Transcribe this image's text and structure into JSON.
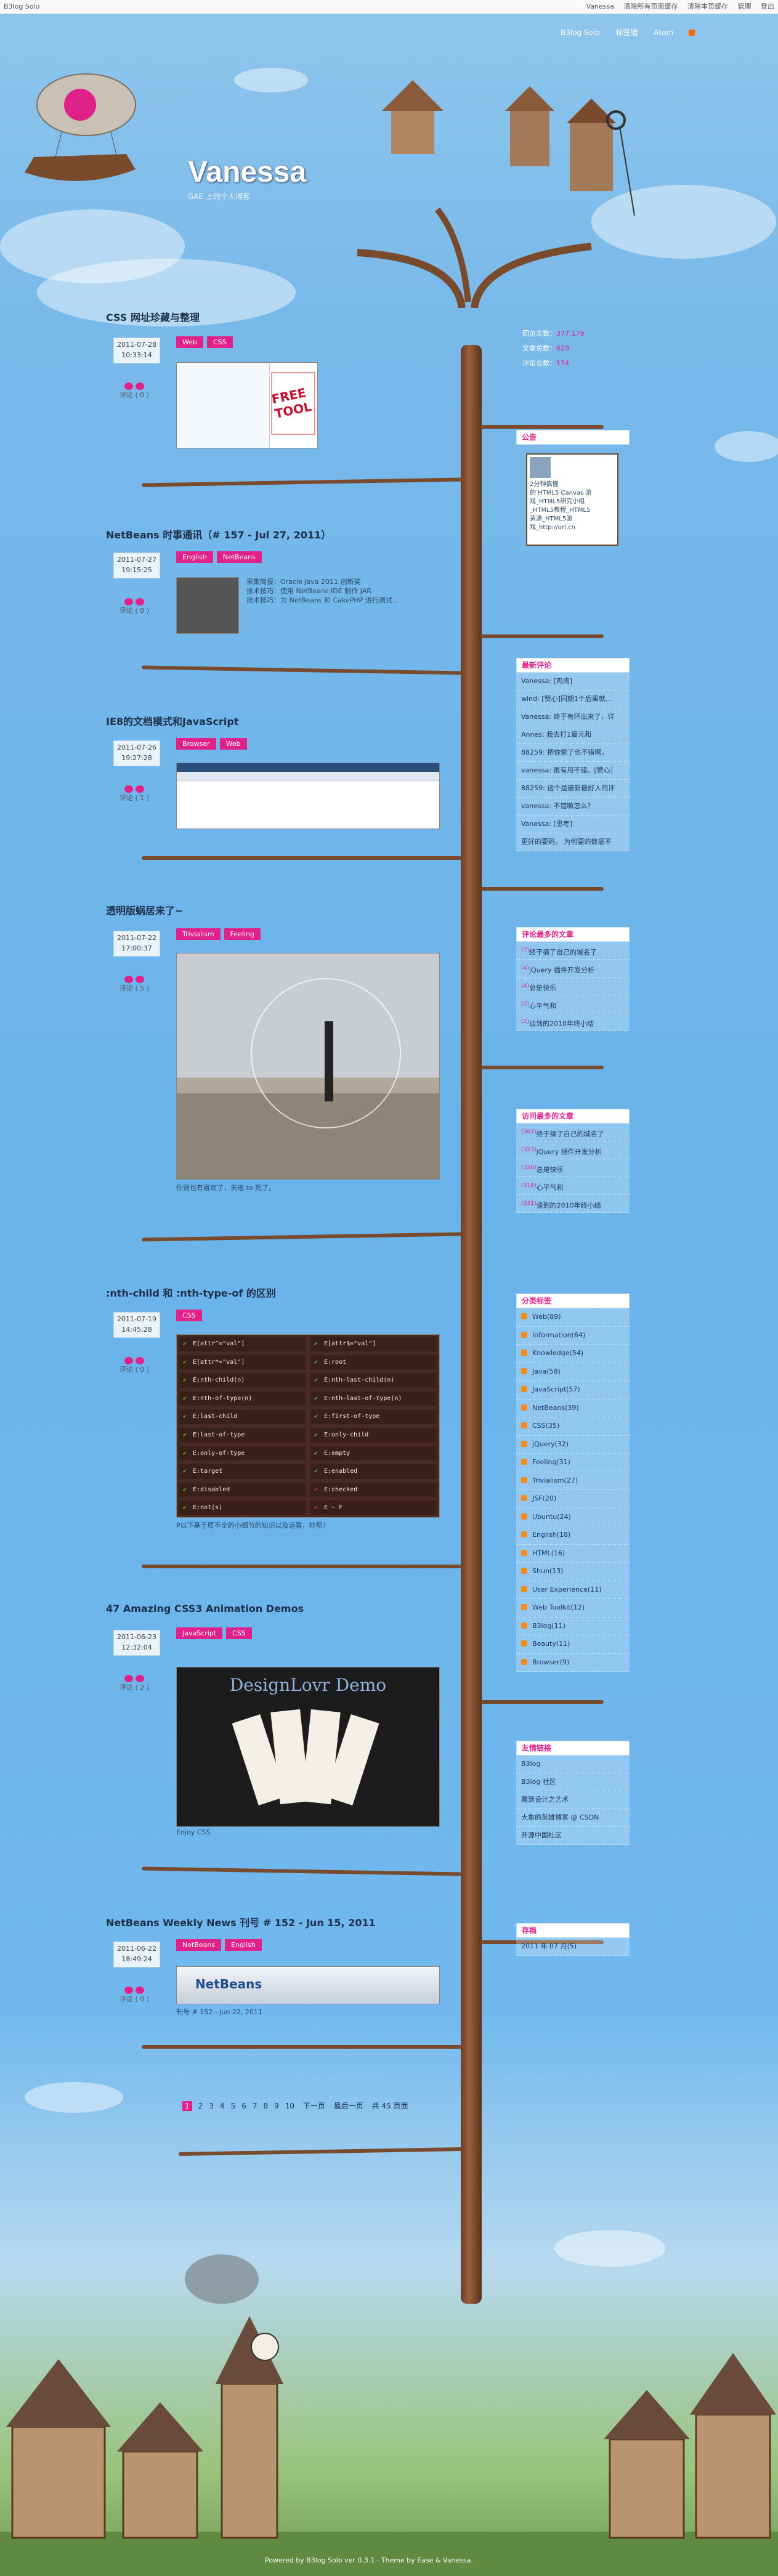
{
  "topbar": {
    "brand": "B3log Solo",
    "links": [
      "Vanessa",
      "清除所有页面缓存",
      "清除本页缓存",
      "管理",
      "登出"
    ]
  },
  "nav": {
    "home": "B3log Solo",
    "links": "标签墙",
    "rss": "Atom"
  },
  "blog": {
    "title": "Vanessa",
    "subtitle": "GAE 上的个人博客"
  },
  "stats": {
    "visits_label": "回览次数：",
    "visits": "377,179",
    "articles_label": "文章总数：",
    "articles": "629",
    "comments_label": "评论总数：",
    "comments": "134"
  },
  "posts": [
    {
      "title": "CSS 网址珍藏与整理",
      "date": "2011-07-28",
      "time": "10:33:14",
      "comment": "评论 ( 0 )",
      "tags": [
        "Web",
        "CSS"
      ],
      "caption": ""
    },
    {
      "title": "NetBeans 时事通讯（# 157 - Jul 27, 2011）",
      "date": "2011-07-27",
      "time": "19:15:25",
      "comment": "评论 ( 0 )",
      "tags": [
        "English",
        "NetBeans"
      ],
      "caption": "",
      "lines": [
        "采集简报：Oracle Java 2011 创新奖",
        "技术技巧：使用 NetBeans IDE 制作 JAR",
        "技术技巧：为 NetBeans 和 CakePHP 进行调试..."
      ]
    },
    {
      "title": "IE8的文档模式和JavaScript",
      "date": "2011-07-26",
      "time": "19:27:28",
      "comment": "评论 ( 1 )",
      "tags": [
        "Browser",
        "Web"
      ],
      "caption": ""
    },
    {
      "title": "透明版蜗居来了~",
      "date": "2011-07-22",
      "time": "17:00:37",
      "comment": "评论 ( 5 )",
      "tags": [
        "Trivialism",
        "Feeling"
      ],
      "caption": "你别也有喜欢了，天地 to 死了。"
    },
    {
      "title": ":nth-child 和 :nth-type-of 的区别",
      "date": "2011-07-19",
      "time": "14:45:28",
      "comment": "评论 ( 0 )",
      "tags": [
        "CSS"
      ],
      "caption": "P以下基于原不全的小细节的知识以及运算，抄帮！"
    },
    {
      "title": "47 Amazing CSS3 Animation Demos",
      "date": "2011-06-23",
      "time": "12:32:04",
      "comment": "评论 ( 2 )",
      "tags": [
        "JavaScript",
        "CSS"
      ],
      "caption": "Enjoy CSS"
    },
    {
      "title": "NetBeans Weekly News 刊号 # 152 - Jun 15, 2011",
      "date": "2011-06-22",
      "time": "18:49:24",
      "comment": "评论 ( 0 )",
      "tags": [
        "NetBeans",
        "English"
      ],
      "caption": "刊号 # 152 - Jun 22, 2011"
    }
  ],
  "selectors": [
    "E[attr^=\"val\"]",
    "E[attr$=\"val\"]",
    "E[attr*=\"val\"]",
    "E:root",
    "E:nth-child(n)",
    "E:nth-last-child(n)",
    "E:nth-of-type(n)",
    "E:nth-last-of-type(n)",
    "E:last-child",
    "E:first-of-type",
    "E:last-of-type",
    "E:only-child",
    "E:only-of-type",
    "E:empty",
    "E:target",
    "E:enabled",
    "E:disabled",
    "E:checked",
    "E:not(s)",
    "E ~ F"
  ],
  "thumbs": {
    "free_tool": "FREE TOOL",
    "designlovr": "DesignLovr Demo",
    "netbeans": "NetBeans"
  },
  "widgets": {
    "notice": {
      "title": "公告",
      "lines": [
        "2分钟搞懂",
        "的 HTML5 Canvas 游",
        "戏_HTML5研究小组",
        "_HTML5教程_HTML5",
        "资源_HTML5游",
        "戏_http://url.cn"
      ]
    },
    "recent_comments": {
      "title": "最新评论",
      "items": [
        "Vanessa: [鸡肉]",
        "wind: [赞心]同期1个后果就...",
        "Vanessa: 终于有环出来了，详",
        "Annes: 我去打1篇元和",
        "88259: 把你索了也不错啊。",
        "vanessa: 很有用不错。[赞心]",
        "88259: 这个是最新最好人的评",
        "vanessa: 不错嘛怎么？",
        "Vanessa: [思考]",
        "更好的要码。 为何要的数据不"
      ]
    },
    "most_commented": {
      "title": "评论最多的文章",
      "items": [
        [
          "(7)",
          "终于搞了自己的城名了"
        ],
        [
          "(4)",
          "jQuery 插件开发分析"
        ],
        [
          "(4)",
          "总是快乐"
        ],
        [
          "(2)",
          "心平气和"
        ],
        [
          "(2)",
          "谈到的2010年终小结"
        ]
      ]
    },
    "most_viewed": {
      "title": "访问最多的文章",
      "items": [
        [
          "(367)",
          "终于搞了自己的城名了"
        ],
        [
          "(323)",
          "jQuery 插件开发分析"
        ],
        [
          "(320)",
          "总是快乐"
        ],
        [
          "(318)",
          "心平气和"
        ],
        [
          "(331)",
          "谈到的2010年终小结"
        ]
      ]
    },
    "categories": {
      "title": "分类标签",
      "items": [
        "Web(89)",
        "Information(64)",
        "Knowledge(54)",
        "Java(58)",
        "JavaScript(57)",
        "NetBeans(39)",
        "CSS(35)",
        "jQuery(32)",
        "Feeling(31)",
        "Trivialism(27)",
        "JSF(20)",
        "Ubuntu(24)",
        "English(18)",
        "HTML(16)",
        "Shun(13)",
        "User Experience(11)",
        "Web Toolkit(12)",
        "B3log(11)",
        "Beauty(11)",
        "Browser(9)"
      ]
    },
    "links": {
      "title": "友情链接",
      "items": [
        "B3log",
        "B3log 社区",
        "雕到设计之艺术",
        "大象的英雄博客 @ CSDN",
        "开源中国社区"
      ]
    },
    "archive": {
      "title": "存档",
      "items": [
        "2011 年 07 月(5)"
      ]
    }
  },
  "pager": {
    "pages": [
      "1",
      "2",
      "3",
      "4",
      "5",
      "6",
      "7",
      "8",
      "9",
      "10"
    ],
    "next": "下一页",
    "last": "最后一页",
    "total": "共 45 页面"
  },
  "footer": "Powered by B3log Solo ver 0.3.1 · Theme by Ease & Vanessa."
}
